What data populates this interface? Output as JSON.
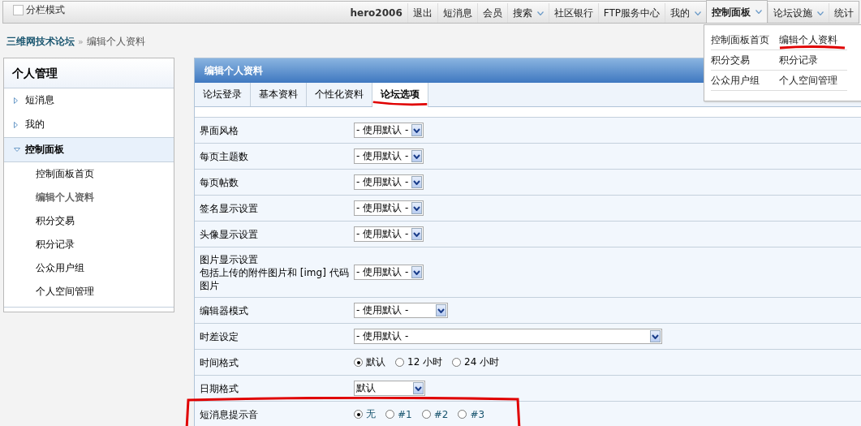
{
  "topbar": {
    "split_mode": {
      "label": "分栏模式",
      "checked": false
    },
    "items": [
      {
        "label": "hero2006",
        "kind": "user",
        "dropdown": false,
        "selected": false
      },
      {
        "label": "退出",
        "kind": "link",
        "dropdown": false,
        "selected": false
      },
      {
        "label": "短消息",
        "kind": "link",
        "dropdown": false,
        "selected": false
      },
      {
        "label": "会员",
        "kind": "link",
        "dropdown": false,
        "selected": false
      },
      {
        "label": "搜索",
        "kind": "link",
        "dropdown": true,
        "selected": false
      },
      {
        "label": "社区银行",
        "kind": "link",
        "dropdown": false,
        "selected": false
      },
      {
        "label": "FTP服务中心",
        "kind": "link",
        "dropdown": false,
        "selected": false
      },
      {
        "label": "我的",
        "kind": "link",
        "dropdown": true,
        "selected": false
      },
      {
        "label": "控制面板",
        "kind": "link",
        "dropdown": true,
        "selected": true
      },
      {
        "label": "论坛设施",
        "kind": "link",
        "dropdown": true,
        "selected": false
      },
      {
        "label": "统计",
        "kind": "link",
        "dropdown": false,
        "selected": false
      }
    ]
  },
  "dropdown_menu": {
    "items": [
      {
        "label": "控制面板首页",
        "annotated": false
      },
      {
        "label": "编辑个人资料",
        "annotated": true
      },
      {
        "label": "积分交易",
        "annotated": false
      },
      {
        "label": "积分记录",
        "annotated": false
      },
      {
        "label": "公众用户组",
        "annotated": false
      },
      {
        "label": "个人空间管理",
        "annotated": false
      }
    ]
  },
  "breadcrumb": {
    "home": "三维网技术论坛",
    "separator": "»",
    "current": "编辑个人资料"
  },
  "sidebar": {
    "title": "个人管理",
    "items": [
      {
        "label": "短消息",
        "expanded": false,
        "selected": false
      },
      {
        "label": "我的",
        "expanded": false,
        "selected": false
      },
      {
        "label": "控制面板",
        "expanded": true,
        "selected": true,
        "children": [
          {
            "label": "控制面板首页",
            "selected": false
          },
          {
            "label": "编辑个人资料",
            "selected": true
          },
          {
            "label": "积分交易",
            "selected": false
          },
          {
            "label": "积分记录",
            "selected": false
          },
          {
            "label": "公众用户组",
            "selected": false
          },
          {
            "label": "个人空间管理",
            "selected": false
          }
        ]
      }
    ]
  },
  "panel": {
    "title": "编辑个人资料",
    "tabs": [
      {
        "label": "论坛登录",
        "selected": false,
        "annotated": false
      },
      {
        "label": "基本资料",
        "selected": false,
        "annotated": false
      },
      {
        "label": "个性化资料",
        "selected": false,
        "annotated": false
      },
      {
        "label": "论坛选项",
        "selected": true,
        "annotated": true
      }
    ],
    "rows": [
      {
        "label": "界面风格",
        "kind": "select",
        "value": "- 使用默认 -",
        "annotated": false
      },
      {
        "label": "每页主题数",
        "kind": "select",
        "value": "- 使用默认 -",
        "annotated": false
      },
      {
        "label": "每页帖数",
        "kind": "select",
        "value": "- 使用默认 -",
        "annotated": false
      },
      {
        "label": "签名显示设置",
        "kind": "select",
        "value": "- 使用默认 -",
        "annotated": false
      },
      {
        "label": "头像显示设置",
        "kind": "select",
        "value": "- 使用默认 -",
        "annotated": false
      },
      {
        "label": "图片显示设置",
        "note": "包括上传的附件图片和 [img] 代码图片",
        "kind": "select",
        "value": "- 使用默认 -",
        "annotated": false
      },
      {
        "label": "编辑器模式",
        "kind": "select",
        "value": "- 使用默认 -",
        "annotated": false
      },
      {
        "label": "时差设定",
        "kind": "select",
        "value": "- 使用默认 -",
        "annotated": false
      },
      {
        "label": "时间格式",
        "kind": "radio",
        "options": [
          {
            "label": "默认",
            "selected": true
          },
          {
            "label": "12 小时",
            "selected": false
          },
          {
            "label": "24 小时",
            "selected": false
          }
        ],
        "annotated": false
      },
      {
        "label": "日期格式",
        "kind": "select",
        "value": "默认",
        "annotated": false
      },
      {
        "label": "短消息提示音",
        "kind": "radio",
        "options": [
          {
            "label": "无",
            "selected": true
          },
          {
            "label": "#1",
            "selected": false
          },
          {
            "label": "#2",
            "selected": false
          },
          {
            "label": "#3",
            "selected": false
          }
        ],
        "annotated": true
      }
    ]
  }
}
